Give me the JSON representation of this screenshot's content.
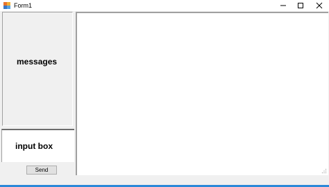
{
  "window": {
    "title": "Form1",
    "icon": "winforms-app-icon",
    "controls": {
      "minimize_icon": "minimize-icon",
      "maximize_icon": "maximize-icon",
      "close_icon": "close-icon"
    }
  },
  "left_panel": {
    "messages_label": "messages",
    "input_label": "input box",
    "send_label": "Send"
  },
  "colors": {
    "window_bg": "#f0f0f0",
    "accent": "#2b88d8"
  }
}
